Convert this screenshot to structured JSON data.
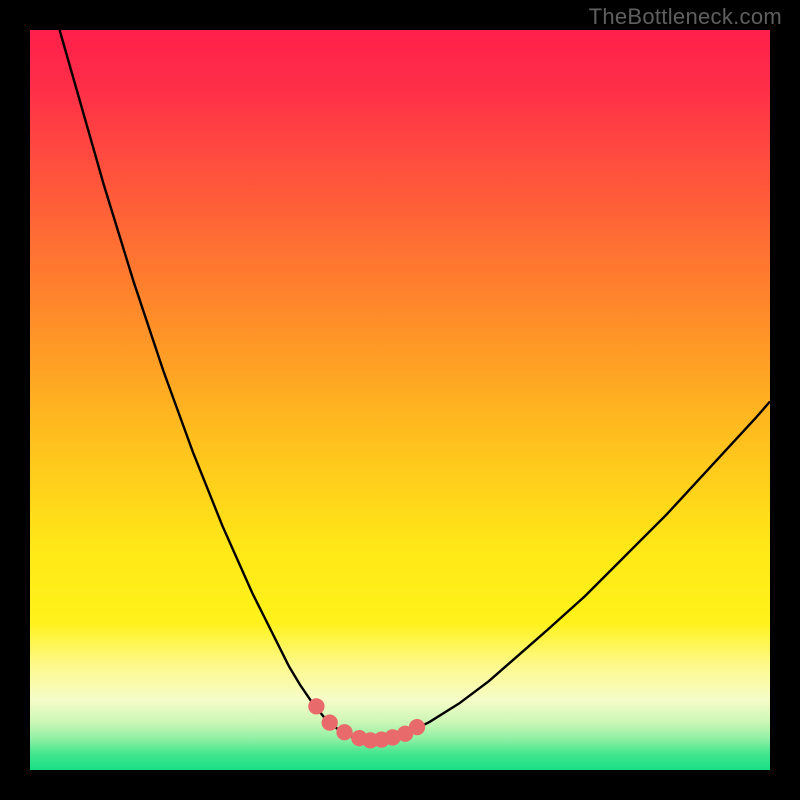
{
  "watermark": "TheBottleneck.com",
  "colors": {
    "frame": "#000000",
    "curve": "#000000",
    "markers": "#e96a6a",
    "gradient_stops": [
      {
        "offset": 0.0,
        "color": "#ff1f4b"
      },
      {
        "offset": 0.08,
        "color": "#ff2f48"
      },
      {
        "offset": 0.22,
        "color": "#ff5a3a"
      },
      {
        "offset": 0.38,
        "color": "#ff8a2a"
      },
      {
        "offset": 0.55,
        "color": "#ffbf1e"
      },
      {
        "offset": 0.7,
        "color": "#ffe817"
      },
      {
        "offset": 0.8,
        "color": "#fff21a"
      },
      {
        "offset": 0.86,
        "color": "#fdf98e"
      },
      {
        "offset": 0.905,
        "color": "#f6fcc8"
      },
      {
        "offset": 0.935,
        "color": "#ccf7b6"
      },
      {
        "offset": 0.958,
        "color": "#8ef0a3"
      },
      {
        "offset": 0.978,
        "color": "#43e68f"
      },
      {
        "offset": 1.0,
        "color": "#18df82"
      }
    ]
  },
  "chart_data": {
    "type": "line",
    "title": "",
    "xlabel": "",
    "ylabel": "",
    "xlim": [
      0,
      100
    ],
    "ylim": [
      0,
      100
    ],
    "grid": false,
    "legend": false,
    "series": [
      {
        "name": "bottleneck-curve",
        "x": [
          4,
          6,
          8,
          10,
          12,
          14,
          16,
          18,
          20,
          22,
          24,
          26,
          28,
          30,
          32,
          33.5,
          35,
          36.5,
          38,
          40,
          42,
          44,
          46,
          48,
          51,
          54,
          58,
          62,
          66,
          70,
          75,
          80,
          86,
          92,
          98,
          100
        ],
        "y": [
          100,
          93,
          86,
          79,
          72.5,
          66,
          60,
          54,
          48.5,
          43,
          38,
          33,
          28.5,
          24,
          20,
          17,
          14,
          11.5,
          9.3,
          6.8,
          5.2,
          4.3,
          4.0,
          4.2,
          5.0,
          6.5,
          9.0,
          12.0,
          15.5,
          19.0,
          23.5,
          28.5,
          34.5,
          41.0,
          47.5,
          49.8
        ]
      }
    ],
    "markers": {
      "name": "selected-range",
      "x": [
        38.7,
        40.5,
        42.5,
        44.5,
        46.0,
        47.5,
        49.0,
        50.7,
        52.3
      ],
      "y": [
        8.6,
        6.4,
        5.1,
        4.3,
        4.0,
        4.1,
        4.4,
        4.9,
        5.8
      ],
      "radius": 1.1
    }
  }
}
